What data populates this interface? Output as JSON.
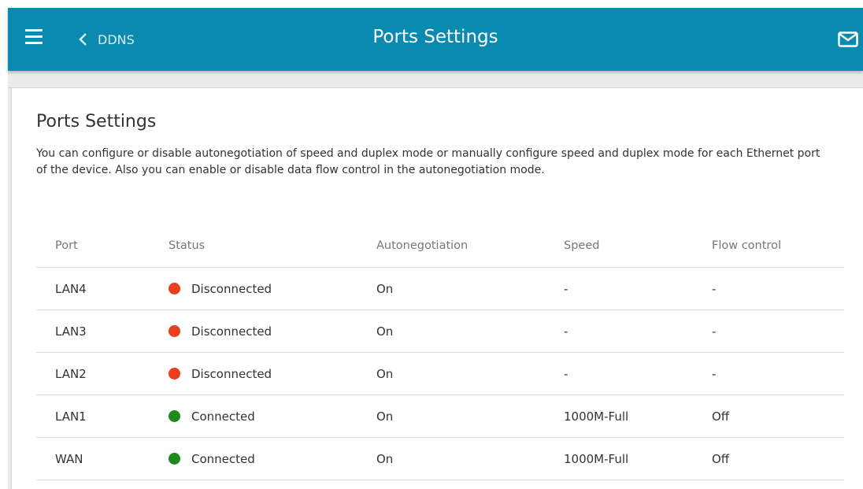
{
  "header": {
    "back_label": "DDNS",
    "title": "Ports Settings"
  },
  "content": {
    "title": "Ports Settings",
    "description": "You can configure or disable autonegotiation of speed and duplex mode or manually configure speed and duplex mode for each Ethernet port of the device. Also you can enable or disable data flow control in the autonegotiation mode."
  },
  "table": {
    "columns": [
      "Port",
      "Status",
      "Autonegotiation",
      "Speed",
      "Flow control"
    ],
    "rows": [
      {
        "port": "LAN4",
        "status": "Disconnected",
        "status_color": "#e8401c",
        "autoneg": "On",
        "speed": "-",
        "flow": "-"
      },
      {
        "port": "LAN3",
        "status": "Disconnected",
        "status_color": "#e8401c",
        "autoneg": "On",
        "speed": "-",
        "flow": "-"
      },
      {
        "port": "LAN2",
        "status": "Disconnected",
        "status_color": "#e8401c",
        "autoneg": "On",
        "speed": "-",
        "flow": "-"
      },
      {
        "port": "LAN1",
        "status": "Connected",
        "status_color": "#1e8a1e",
        "autoneg": "On",
        "speed": "1000M-Full",
        "flow": "Off"
      },
      {
        "port": "WAN",
        "status": "Connected",
        "status_color": "#1e8a1e",
        "autoneg": "On",
        "speed": "1000M-Full",
        "flow": "Off"
      }
    ]
  },
  "colors": {
    "topbar": "#0a8ab0",
    "disconnected": "#e8401c",
    "connected": "#1e8a1e"
  },
  "icons": {
    "menu": "hamburger-menu-icon",
    "back": "chevron-left-icon",
    "mail": "mail-icon"
  }
}
